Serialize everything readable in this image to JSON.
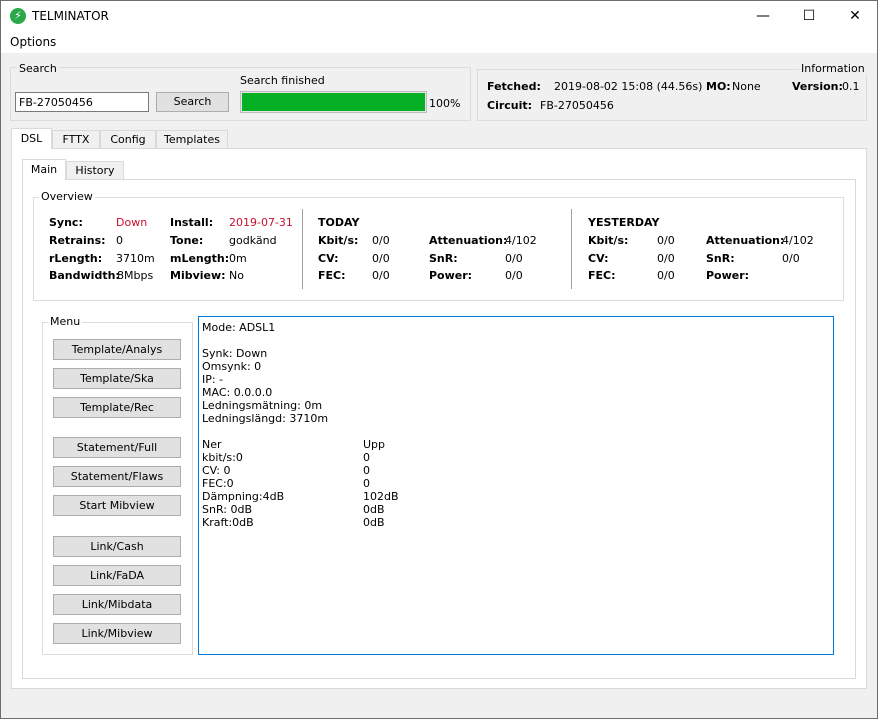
{
  "window": {
    "title": "TELMINATOR",
    "icon": "lightning-icon",
    "controls": {
      "minimize": "—",
      "maximize": "☐",
      "close": "✕"
    }
  },
  "menubar": {
    "options": "Options"
  },
  "search": {
    "group_label": "Search",
    "value": "FB-27050456",
    "button": "Search",
    "status": "Search finished",
    "progress_percent": 100,
    "progress_label": "100%",
    "progress_color": "#06b025"
  },
  "information": {
    "group_label": "Information",
    "fetched_label": "Fetched:",
    "fetched_value": "2019-08-02 15:08 (44.56s)",
    "mo_label": "MO:",
    "mo_value": "None",
    "version_label": "Version:",
    "version_value": "0.1",
    "circuit_label": "Circuit:",
    "circuit_value": "FB-27050456"
  },
  "tabs": [
    "DSL",
    "FTTX",
    "Config",
    "Templates"
  ],
  "subtabs": [
    "Main",
    "History"
  ],
  "overview": {
    "group_label": "Overview",
    "left": [
      {
        "label": "Sync:",
        "value": "Down",
        "label2": "Install:",
        "value2": "2019-07-31"
      },
      {
        "label": "Retrains:",
        "value": "0",
        "label2": "Tone:",
        "value2": "godkänd"
      },
      {
        "label": "rLength:",
        "value": "3710m",
        "label2": "mLength:",
        "value2": "0m"
      },
      {
        "label": "Bandwidth:",
        "value": "8Mbps",
        "label2": "Mibview:",
        "value2": "No"
      }
    ],
    "today": {
      "heading": "TODAY",
      "rows": [
        {
          "label": "Kbit/s:",
          "value": "0/0",
          "label2": "Attenuation:",
          "value2": "4/102"
        },
        {
          "label": "CV:",
          "value": "0/0",
          "label2": "SnR:",
          "value2": "0/0"
        },
        {
          "label": "FEC:",
          "value": "0/0",
          "label2": "Power:",
          "value2": "0/0"
        }
      ]
    },
    "yesterday": {
      "heading": "YESTERDAY",
      "rows": [
        {
          "label": "Kbit/s:",
          "value": "0/0",
          "label2": "Attenuation:",
          "value2": "4/102"
        },
        {
          "label": "CV:",
          "value": "0/0",
          "label2": "SnR:",
          "value2": "0/0"
        },
        {
          "label": "FEC:",
          "value": "0/0",
          "label2": "Power:",
          "value2": ""
        }
      ]
    }
  },
  "menu": {
    "group_label": "Menu",
    "buttons": [
      "Template/Analys",
      "Template/Ska",
      "Template/Rec",
      "Statement/Full",
      "Statement/Flaws",
      "Start Mibview",
      "Link/Cash",
      "Link/FaDA",
      "Link/Mibdata",
      "Link/Mibview"
    ]
  },
  "output": {
    "mode": "Mode: ADSL1",
    "lines": [
      "Synk: Down",
      "Omsynk: 0",
      "IP: -",
      "MAC: 0.0.0.0",
      "Ledningsmätning: 0m",
      "Ledningslängd: 3710m"
    ],
    "table": [
      [
        "Ner",
        "Upp"
      ],
      [
        "kbit/s:0",
        "0"
      ],
      [
        "CV: 0",
        "0"
      ],
      [
        "FEC:0",
        "0"
      ],
      [
        "Dämpning:4dB",
        "102dB"
      ],
      [
        "SnR: 0dB",
        "0dB"
      ],
      [
        "Kraft:0dB",
        "0dB"
      ]
    ]
  }
}
